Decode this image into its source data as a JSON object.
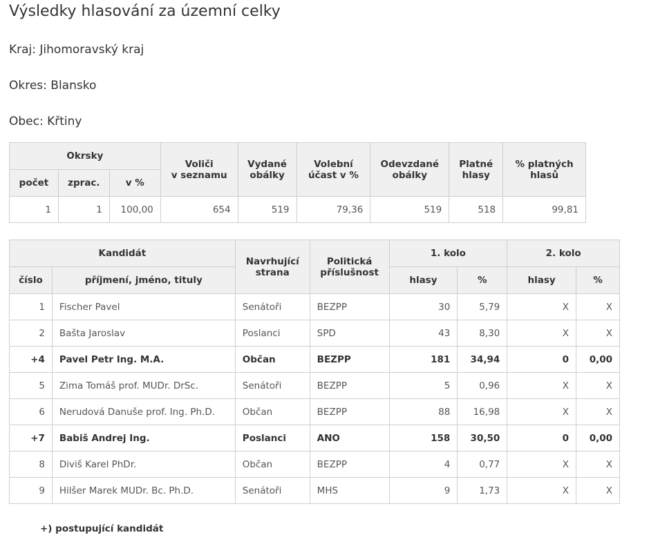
{
  "page": {
    "title": "Výsledky hlasování za územní celky",
    "kraj": "Kraj: Jihomoravský kraj",
    "okres": "Okres: Blansko",
    "obec": "Obec: Křtiny"
  },
  "summary": {
    "headers": {
      "okrsky": "Okrsky",
      "pocet": "počet",
      "zprac": "zprac.",
      "vpct": "v %",
      "volici_1": "Voliči",
      "volici_2": "v seznamu",
      "vydane_1": "Vydané",
      "vydane_2": "obálky",
      "ucast_1": "Volební",
      "ucast_2": "účast v %",
      "odevzdane_1": "Odevzdané",
      "odevzdane_2": "obálky",
      "platne_1": "Platné",
      "platne_2": "hlasy",
      "pct_1": "% platných",
      "pct_2": "hlasů"
    },
    "row": {
      "pocet": "1",
      "zprac": "1",
      "vpct": "100,00",
      "volici": "654",
      "vydane": "519",
      "ucast": "79,36",
      "odevzdane": "519",
      "platne": "518",
      "pct_platnych": "99,81"
    }
  },
  "candidates": {
    "headers": {
      "kandidat": "Kandidát",
      "cislo": "číslo",
      "jmeno": "příjmení, jméno, tituly",
      "strana_1": "Navrhující",
      "strana_2": "strana",
      "prislusnost_1": "Politická",
      "prislusnost_2": "příslušnost",
      "kolo1": "1. kolo",
      "kolo2": "2. kolo",
      "hlasy": "hlasy",
      "pct": "%"
    },
    "rows": [
      {
        "cislo": "1",
        "jmeno": "Fischer Pavel",
        "strana": "Senátoři",
        "prislusnost": "BEZPP",
        "hlasy1": "30",
        "pct1": "5,79",
        "hlasy2": "X",
        "pct2": "X",
        "bold": false
      },
      {
        "cislo": "2",
        "jmeno": "Bašta Jaroslav",
        "strana": "Poslanci",
        "prislusnost": "SPD",
        "hlasy1": "43",
        "pct1": "8,30",
        "hlasy2": "X",
        "pct2": "X",
        "bold": false
      },
      {
        "cislo": "+4",
        "jmeno": "Pavel Petr Ing. M.A.",
        "strana": "Občan",
        "prislusnost": "BEZPP",
        "hlasy1": "181",
        "pct1": "34,94",
        "hlasy2": "0",
        "pct2": "0,00",
        "bold": true
      },
      {
        "cislo": "5",
        "jmeno": "Zima Tomáš prof. MUDr. DrSc.",
        "strana": "Senátoři",
        "prislusnost": "BEZPP",
        "hlasy1": "5",
        "pct1": "0,96",
        "hlasy2": "X",
        "pct2": "X",
        "bold": false
      },
      {
        "cislo": "6",
        "jmeno": "Nerudová Danuše prof. Ing. Ph.D.",
        "strana": "Občan",
        "prislusnost": "BEZPP",
        "hlasy1": "88",
        "pct1": "16,98",
        "hlasy2": "X",
        "pct2": "X",
        "bold": false
      },
      {
        "cislo": "+7",
        "jmeno": "Babiš Andrej Ing.",
        "strana": "Poslanci",
        "prislusnost": "ANO",
        "hlasy1": "158",
        "pct1": "30,50",
        "hlasy2": "0",
        "pct2": "0,00",
        "bold": true
      },
      {
        "cislo": "8",
        "jmeno": "Diviš Karel PhDr.",
        "strana": "Občan",
        "prislusnost": "BEZPP",
        "hlasy1": "4",
        "pct1": "0,77",
        "hlasy2": "X",
        "pct2": "X",
        "bold": false
      },
      {
        "cislo": "9",
        "jmeno": "Hilšer Marek MUDr. Bc. Ph.D.",
        "strana": "Senátoři",
        "prislusnost": "MHS",
        "hlasy1": "9",
        "pct1": "1,73",
        "hlasy2": "X",
        "pct2": "X",
        "bold": false
      }
    ]
  },
  "footnote": "+) postupující kandidát"
}
